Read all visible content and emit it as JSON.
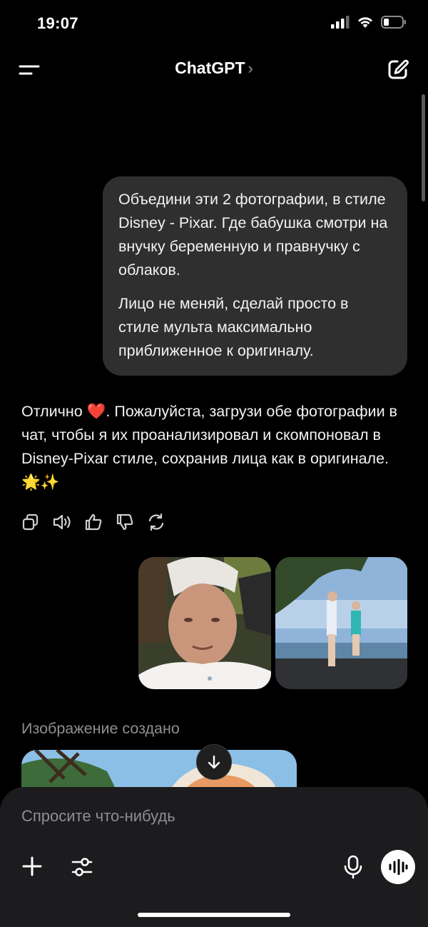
{
  "status_bar": {
    "time": "19:07"
  },
  "header": {
    "title": "ChatGPT",
    "chevron": "›"
  },
  "user_message": {
    "paragraph_1": "Объедини эти 2 фотографии, в стиле Disney - Pixar. Где бабушка смотри на внучку беременную и правнучку с облаков.",
    "paragraph_2": "Лицо не меняй, сделай просто в стиле мульта максимально приближенное к оригиналу."
  },
  "assistant_message": {
    "text": "Отлично ❤️. Пожалуйста, загрузи обе фото­графии в чат, чтобы я их проанализировал и скомпоновал в Disney-Pixar стиле, сохранив лица как в оригинале. 🌟✨"
  },
  "message_actions": [
    "copy-icon",
    "speaker-icon",
    "thumbs-up-icon",
    "thumbs-down-icon",
    "regenerate-icon"
  ],
  "attachments": [
    "photo-grandmother",
    "photo-mother-daughter-seaside"
  ],
  "image_created_label": "Изображение создано",
  "composer": {
    "placeholder": "Спросите что-нибудь"
  },
  "colors": {
    "background": "#000000",
    "bubble": "#2f2f2f",
    "composer": "#1c1c1e",
    "muted_text": "#8e8e93"
  }
}
